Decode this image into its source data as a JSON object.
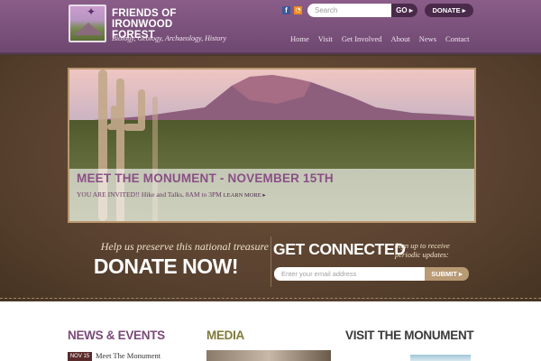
{
  "site": {
    "title": "FRIENDS OF IRONWOOD FOREST",
    "subtitle": "Biology, Geology, Archaeology, History"
  },
  "header": {
    "social_icons": [
      "facebook-icon",
      "rss-icon"
    ],
    "search": {
      "placeholder": "Search",
      "value": "",
      "button_label": "GO ▸"
    },
    "donate_label": "DONATE ▸",
    "nav": [
      "Home",
      "Visit",
      "Get Involved",
      "About",
      "News",
      "Contact"
    ]
  },
  "hero": {
    "title": "MEET THE MONUMENT - NOVEMBER 15TH",
    "text": "YOU ARE INVITED!! Hike and Talks, 8AM to 3PM",
    "learn_more": "LEARN MORE ▸"
  },
  "donate_section": {
    "help_text": "Help us preserve this national treasure",
    "donate_label": "DONATE NOW!"
  },
  "connect_section": {
    "title": "GET CONNECTED",
    "signup_text": "Sign up to receive periodic updates:",
    "email_placeholder": "Enter your email address",
    "submit_label": "SUBMIT ▸"
  },
  "bottom": {
    "news_title": "NEWS & EVENTS",
    "media_title": "MEDIA",
    "visit_title": "VISIT THE MONUMENT",
    "news_items": [
      {
        "date": "NOV 15",
        "label": "Meet The Monument"
      }
    ]
  },
  "colors": {
    "header_purple": "#7a527b",
    "leather_brown": "#5a4230",
    "hero_title": "#8a4f86",
    "news_title": "#7a4a78",
    "media_title": "#7f7a3a"
  }
}
